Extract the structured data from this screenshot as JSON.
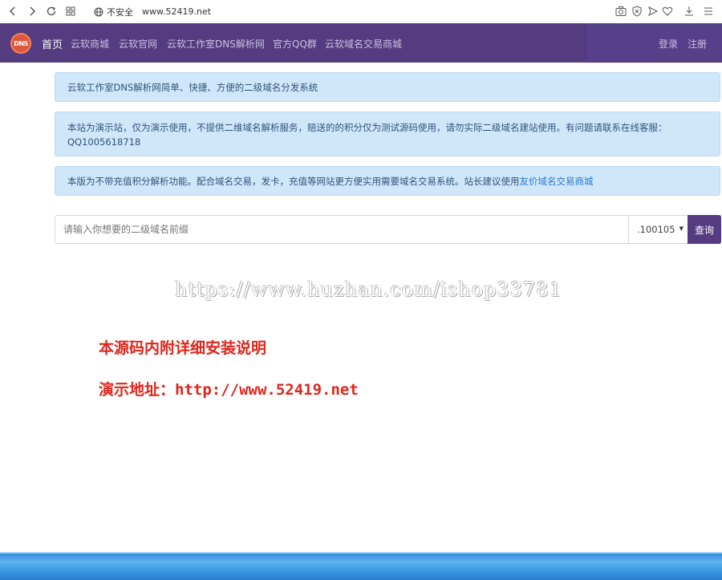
{
  "browser": {
    "security_label": "不安全",
    "url": "www.52419.net"
  },
  "site": {
    "logo_text": "DNS",
    "nav": [
      {
        "label": "首页"
      },
      {
        "label": "云软商城"
      },
      {
        "label": "云软官网"
      },
      {
        "label": "云软工作室DNS解析网"
      },
      {
        "label": "官方QQ群"
      },
      {
        "label": "云软域名交易商城"
      }
    ],
    "login_label": "登录",
    "register_label": "注册"
  },
  "alerts": {
    "intro": "云软工作室DNS解析网简单、快捷、方便的二级域名分发系统",
    "notice_line1": "本站为演示站，仅为演示使用，不提供二维域名解析服务，赔送的的积分仅为测试源码使用，请勿实际二级域名建站使用。有问题请联系在线客服：",
    "notice_line2": "QQ1005618718",
    "version_text": "本版为不带充值积分解析功能。配合域名交易，发卡，充值等网站更方便实用需要域名交易系统。站长建议使用",
    "version_link": "友价域名交易商城"
  },
  "search": {
    "placeholder": "请输入你想要的二级域名前缀",
    "suffix_selected": ".100105",
    "query_label": "查询"
  },
  "overlay": {
    "watermark": "https://www.huzhan.com/ishop33781",
    "install_note": "本源码内附详细安装说明",
    "demo_address": "演示地址：http://www.52419.net"
  },
  "colors": {
    "navbar": "#553c80",
    "alert_bg": "#d0e7fa",
    "red_text": "#e1251b",
    "query_button": "#553c80"
  }
}
